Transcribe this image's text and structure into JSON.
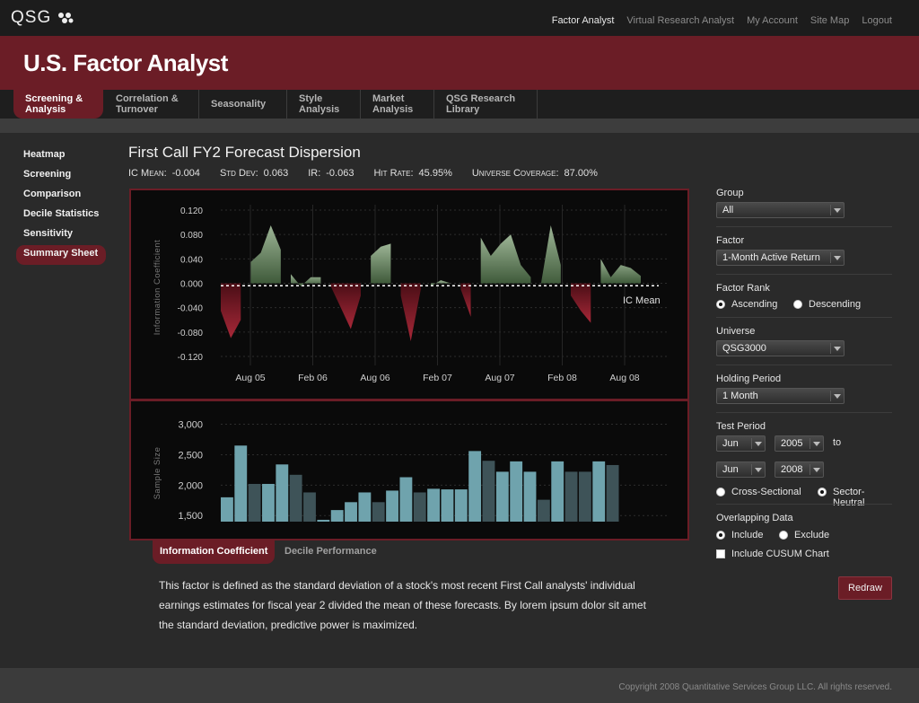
{
  "brand": {
    "logo_text": "QSG"
  },
  "topnav": [
    "Factor Analyst",
    "Virtual Research Analyst",
    "My Account",
    "Site Map",
    "Logout"
  ],
  "header": {
    "title": "U.S. Factor Analyst"
  },
  "tabs": [
    {
      "label": "Screening & Analysis"
    },
    {
      "label": "Correlation & Turnover"
    },
    {
      "label": "Seasonality"
    },
    {
      "label": "Style Analysis"
    },
    {
      "label": "Market Analysis"
    },
    {
      "label": "QSG Research Library"
    }
  ],
  "sidenav": [
    "Heatmap",
    "Screening",
    "Comparison",
    "Decile Statistics",
    "Sensitivity",
    "Summary Sheet"
  ],
  "page": {
    "title": "First Call FY2 Forecast Dispersion",
    "stats": [
      {
        "key": "IC Mean:",
        "value": "-0.004"
      },
      {
        "key": "Std Dev:",
        "value": "0.063"
      },
      {
        "key": "IR:",
        "value": "-0.063"
      },
      {
        "key": "Hit Rate:",
        "value": "45.95%"
      },
      {
        "key": "Universe Coverage:",
        "value": "87.00%"
      }
    ]
  },
  "chart_data": [
    {
      "type": "area",
      "ylabel": "Information Coefficient",
      "ylim": [
        -0.12,
        0.12
      ],
      "yticks": [
        "0.120",
        "0.080",
        "0.040",
        "0.000",
        "-0.040",
        "-0.080",
        "-0.120"
      ],
      "xticks": [
        "Aug 05",
        "Feb 06",
        "Aug 06",
        "Feb 07",
        "Aug 07",
        "Feb 08",
        "Aug 08"
      ],
      "annotation": "IC Mean",
      "ic_mean": -0.004,
      "segments": [
        [
          -0.045,
          -0.09,
          -0.06
        ],
        [
          0.035,
          0.05,
          0.095,
          0.055
        ],
        [
          0.015,
          -0.005,
          0.01,
          0.01
        ],
        [
          -0.005,
          -0.04,
          -0.075,
          -0.02
        ],
        [
          0.045,
          0.06,
          0.065
        ],
        [
          -0.02,
          -0.095,
          -0.01
        ],
        [
          -0.005,
          0.005,
          0.0
        ],
        [
          -0.01,
          -0.055
        ],
        [
          0.075,
          0.045,
          0.065,
          0.08,
          0.03,
          0.01
        ],
        [
          -0.003,
          0.095,
          0.03
        ],
        [
          -0.02,
          -0.045,
          -0.065
        ],
        [
          0.04,
          0.01,
          0.03,
          0.025,
          0.012
        ]
      ],
      "colors": {
        "positive": "#7c9a72",
        "negative": "#8a1e2c"
      },
      "grid": true
    },
    {
      "type": "bar",
      "ylabel": "Sample Size",
      "ylim": [
        1400,
        3200
      ],
      "yticks": [
        "3,000",
        "2,500",
        "2,000",
        "1,500"
      ],
      "values": [
        1800,
        2650,
        2020,
        2020,
        2340,
        2170,
        1880,
        1430,
        1590,
        1720,
        1880,
        1720,
        1910,
        2130,
        1880,
        1940,
        1930,
        1930,
        2560,
        2400,
        2220,
        2390,
        2220,
        1760,
        2390,
        2220,
        2220,
        2390,
        2330
      ],
      "highlight": [
        true,
        true,
        false,
        true,
        true,
        false,
        false,
        true,
        true,
        true,
        true,
        false,
        true,
        true,
        false,
        true,
        true,
        true,
        true,
        false,
        true,
        true,
        true,
        false,
        true,
        false,
        false,
        true,
        false
      ],
      "colors": {
        "highlight": "#6fa3ad",
        "normal": "#3e5358"
      },
      "grid": true
    }
  ],
  "subtabs": [
    "Information Coefficient",
    "Decile Performance"
  ],
  "description": "This factor is defined as the standard deviation of a stock's most recent First Call analysts' individual earnings estimates for fiscal year 2 divided the mean of these forecasts.  By lorem ipsum dolor sit amet the standard deviation, predictive power is maximized.",
  "controls": {
    "group": {
      "label": "Group",
      "value": "All"
    },
    "factor": {
      "label": "Factor",
      "value": "1-Month Active Return"
    },
    "factor_rank": {
      "label": "Factor Rank",
      "options": [
        "Ascending",
        "Descending"
      ],
      "selected": "Ascending"
    },
    "universe": {
      "label": "Universe",
      "value": "QSG3000"
    },
    "holding": {
      "label": "Holding Period",
      "value": "1 Month"
    },
    "test_period": {
      "label": "Test Period",
      "start_month": "Jun",
      "start_year": "2005",
      "to": "to",
      "end_month": "Jun",
      "end_year": "2008"
    },
    "method": {
      "options": [
        "Cross-Sectional",
        "Sector-Neutral"
      ],
      "selected": "Sector-Neutral"
    },
    "overlap": {
      "label": "Overlapping Data",
      "options": [
        "Include",
        "Exclude"
      ],
      "selected": "Include"
    },
    "cusum": {
      "label": "Include CUSUM Chart",
      "checked": false
    },
    "redraw": "Redraw"
  },
  "footer": "Copyright 2008 Quantitative Services Group LLC.  All rights reserved.",
  "theme": {
    "accent": "#6b1d26"
  }
}
